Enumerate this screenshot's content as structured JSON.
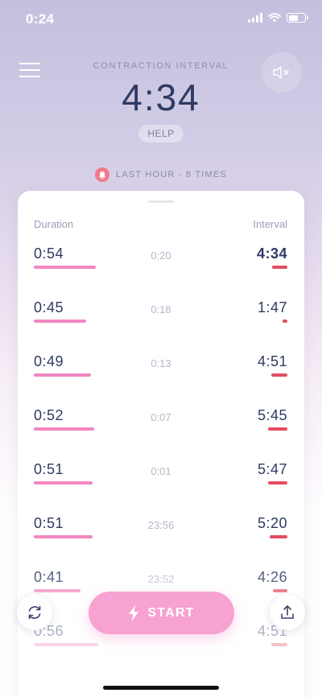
{
  "status": {
    "time": "0:24"
  },
  "header": {
    "label": "CONTRACTION INTERVAL",
    "value": "4:34",
    "help_label": "HELP",
    "menu_icon": "hamburger-menu-icon",
    "mute_icon": "speaker-muted-icon"
  },
  "last_hour": {
    "text": "LAST HOUR - 8 TIMES",
    "icon": "bell-icon",
    "color": "#f07a8c"
  },
  "table": {
    "duration_header": "Duration",
    "interval_header": "Interval",
    "rows": [
      {
        "duration": "0:54",
        "time": "0:20",
        "interval": "4:34",
        "latest": true
      },
      {
        "duration": "0:45",
        "time": "0:18",
        "interval": "1:47"
      },
      {
        "duration": "0:49",
        "time": "0:13",
        "interval": "4:51"
      },
      {
        "duration": "0:52",
        "time": "0:07",
        "interval": "5:45"
      },
      {
        "duration": "0:51",
        "time": "0:01",
        "interval": "5:47"
      },
      {
        "duration": "0:51",
        "time": "23:56",
        "interval": "5:20"
      },
      {
        "duration": "0:41",
        "time": "23:52",
        "interval": "4:26"
      },
      {
        "duration": "0:56",
        "time": "",
        "interval": "4:51"
      }
    ]
  },
  "controls": {
    "start_label": "START",
    "start_icon": "lightning-bolt-icon",
    "reset_icon": "refresh-icon",
    "share_icon": "upload-icon"
  },
  "colors": {
    "duration_bar": "#f186c0",
    "interval_bar": "#e34d62",
    "start_button": "#f7a2d1",
    "text_primary": "#2f3a63"
  }
}
